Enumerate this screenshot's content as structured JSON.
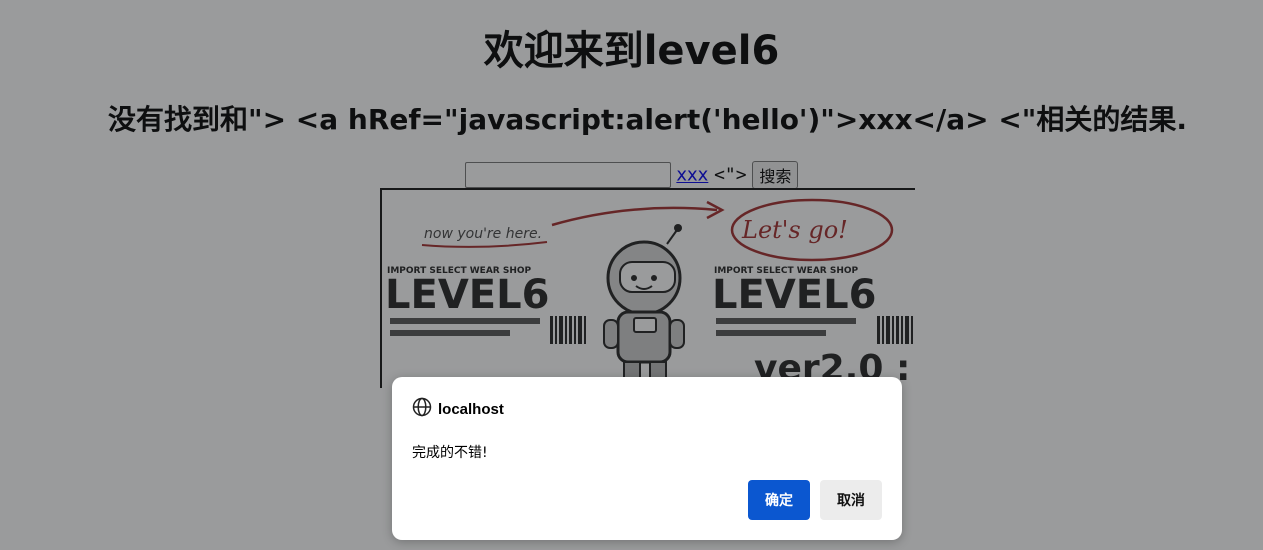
{
  "page": {
    "title": "欢迎来到level6",
    "result_text": "没有找到和\"> <a hRef=\"javascript:alert('hello')\">xxx</a> <\"相关的结果.",
    "search": {
      "input_value": "",
      "link_text": "xxx",
      "tail_text": "<\">",
      "button_label": "搜索"
    }
  },
  "banner": {
    "handwriting_left": "now you're here.",
    "handwriting_right": "Let's go!",
    "shop_text_left": "IMPORT SELECT WEAR SHOP",
    "shop_text_right": "IMPORT SELECT WEAR SHOP",
    "logo_left": "LEVEL6",
    "logo_right": "LEVEL6",
    "version": "ver2.0 :"
  },
  "dialog": {
    "host": "localhost",
    "message": "完成的不错!",
    "ok_label": "确定",
    "cancel_label": "取消",
    "icon": "globe-icon",
    "ok_color": "#0b57d0"
  }
}
